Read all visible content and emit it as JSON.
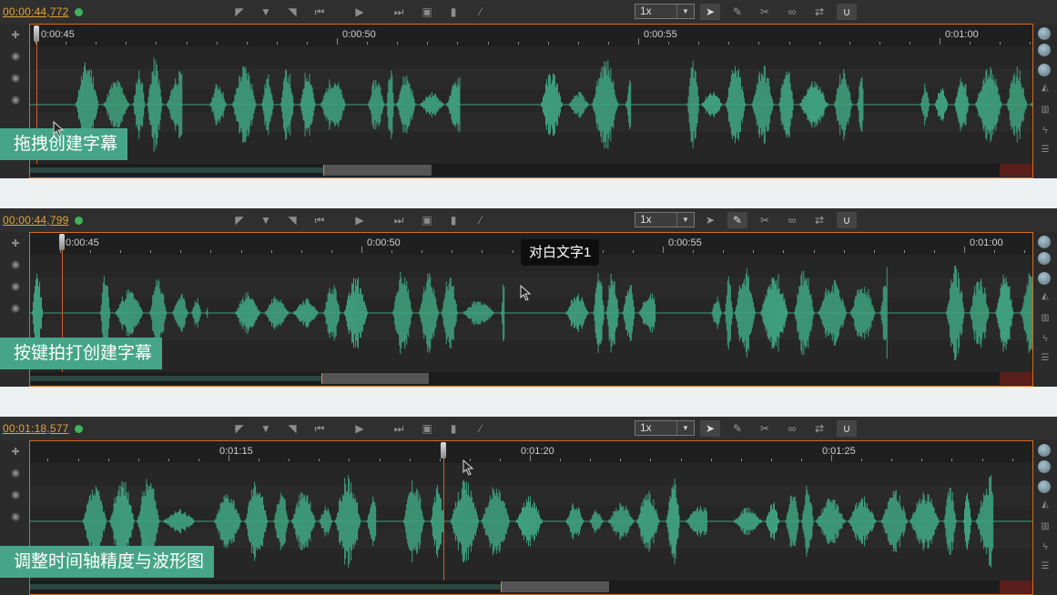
{
  "colors": {
    "waveform": "#3f9f7e",
    "accent": "#d56a1f",
    "timecode": "#e2a23a",
    "caption_bg": "#46a586"
  },
  "toolbar_icons": [
    "mark-in-icon",
    "mark-down-icon",
    "mark-out-icon",
    "skip-back-icon",
    "play-icon",
    "skip-forward-icon",
    "camera-icon",
    "bookmark-icon",
    "magic-wand-icon"
  ],
  "tool_icons": [
    "pointer-icon",
    "edit-icon",
    "scissors-icon",
    "link-icon",
    "swap-icon",
    "magnet-icon"
  ],
  "left_icons": [
    "add-icon",
    "eye-icon",
    "eye-icon",
    "eye-icon"
  ],
  "right_icons": [
    "globe-icon",
    "globe-icon",
    "globe-icon",
    "area-chart-icon",
    "bar-chart-icon",
    "lightning-icon",
    "list-icon"
  ],
  "panels": [
    {
      "timecode": "00:00:44,772",
      "speed": "1x",
      "ruler_labels": [
        "0:00:45",
        "0:00:50",
        "0:00:55",
        "0:01:00"
      ],
      "caption": "拖拽创建字幕"
    },
    {
      "timecode": "00:00:44,799",
      "speed": "1x",
      "ruler_labels": [
        "0:00:45",
        "0:00:50",
        "0:00:55",
        "0:01:00"
      ],
      "caption": "按键拍打创建字幕",
      "tooltip": "对白文字1"
    },
    {
      "timecode": "00:01:18,577",
      "speed": "1x",
      "ruler_labels": [
        "0:01:15",
        "0:01:20",
        "0:01:25"
      ],
      "caption": "调整时间轴精度与波形图"
    }
  ]
}
